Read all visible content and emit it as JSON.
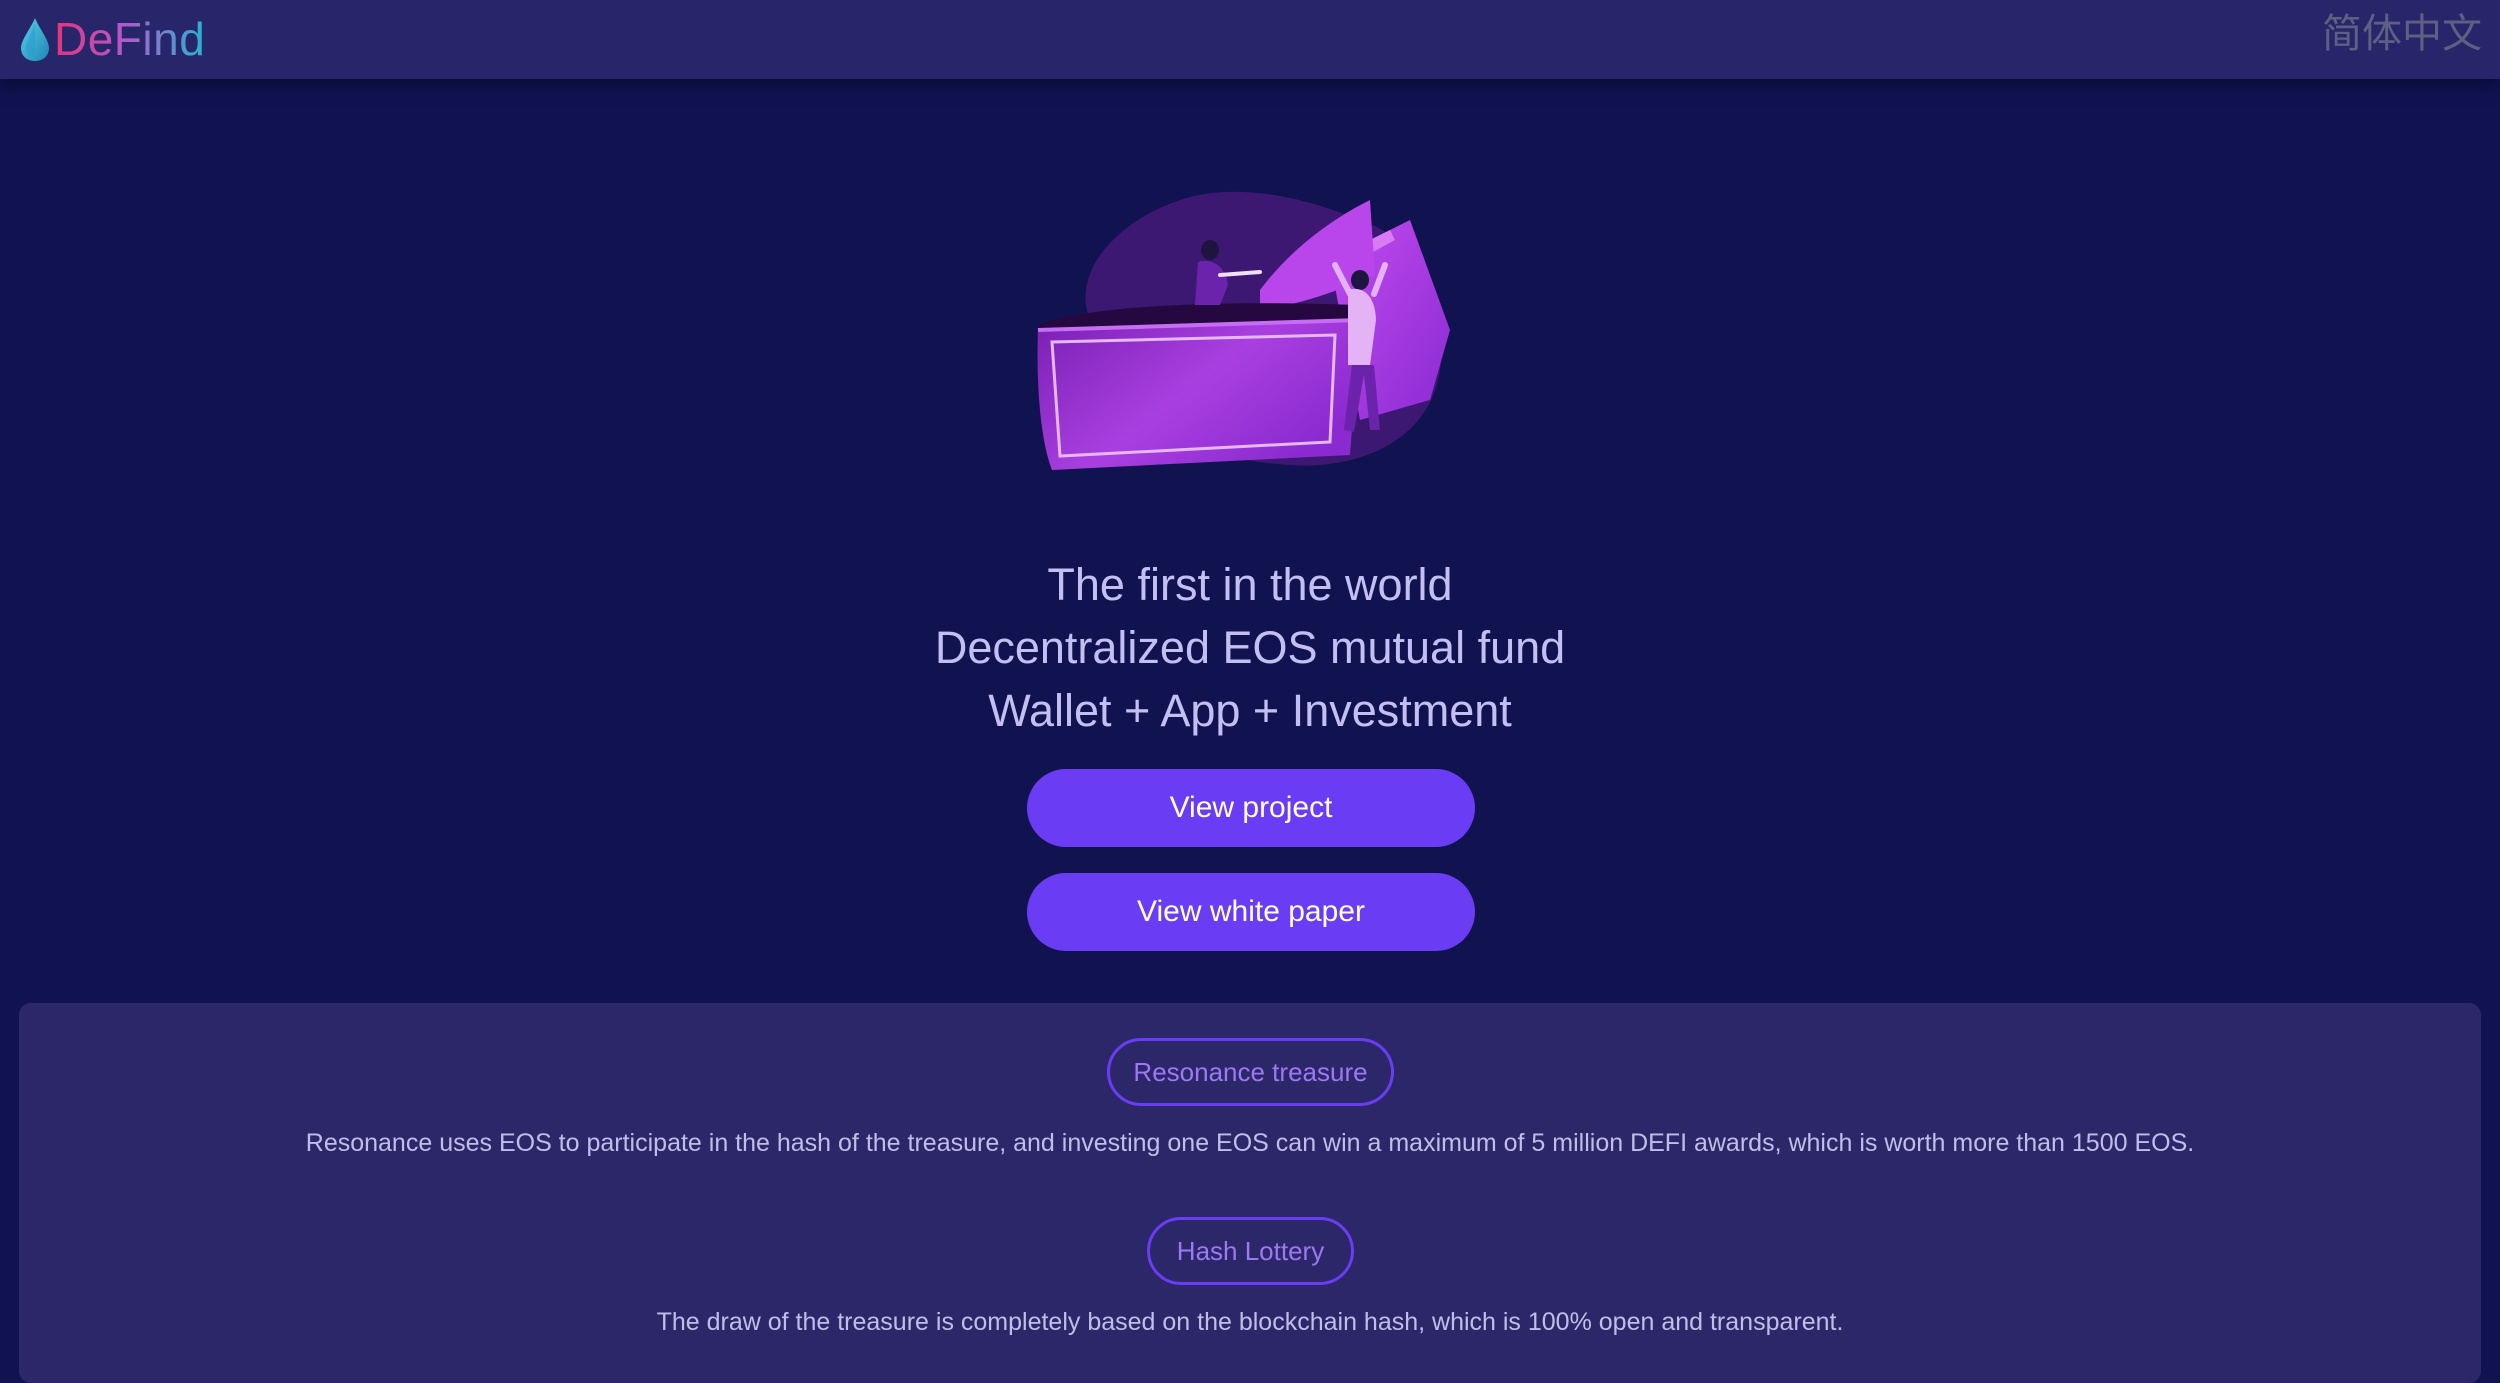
{
  "header": {
    "logo_text": "DeFind",
    "language_link": "简体中文"
  },
  "hero": {
    "illustration": "wallet-with-people-illustration",
    "headline": [
      "The first in the world",
      "Decentralized EOS mutual fund",
      "Wallet + App + Investment"
    ],
    "buttons": {
      "view_project": "View project",
      "view_white_paper": "View white paper"
    }
  },
  "sections": [
    {
      "tag": "Resonance treasure",
      "description": "Resonance uses EOS to participate in the hash of the treasure, and investing one EOS can win a maximum of 5 million DEFI awards, which is worth more than 1500 EOS."
    },
    {
      "tag": "Hash Lottery",
      "description": "The draw of the treasure is completely based on the blockchain hash, which is 100% open and transparent."
    }
  ],
  "colors": {
    "background": "#10134f",
    "header": "#27266a",
    "panel": "#2c2768",
    "accent": "#6a3df4",
    "text": "#c3bff2"
  }
}
